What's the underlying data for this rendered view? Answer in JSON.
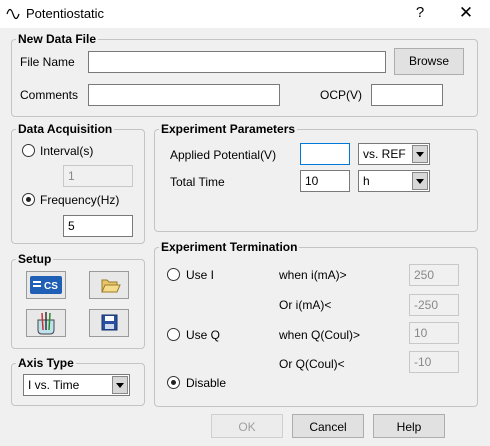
{
  "window": {
    "title": "Potentiostatic",
    "help_glyph": "?",
    "close_glyph": "✕"
  },
  "new_data_file": {
    "legend": "New Data File",
    "file_name_label": "File Name",
    "file_name_value": "",
    "browse_label": "Browse",
    "comments_label": "Comments",
    "comments_value": "",
    "ocp_label": "OCP(V)",
    "ocp_value": ""
  },
  "data_acquisition": {
    "legend": "Data Acquisition",
    "interval_label": "Interval(s)",
    "interval_value": "1",
    "frequency_label": "Frequency(Hz)",
    "frequency_value": "5",
    "selected": "frequency"
  },
  "experiment_parameters": {
    "legend": "Experiment Parameters",
    "applied_potential_label": "Applied Potential(V)",
    "applied_potential_value": "",
    "reference_selected": "vs. REF",
    "total_time_label": "Total Time",
    "total_time_value": "10",
    "time_unit_selected": "h"
  },
  "setup": {
    "legend": "Setup",
    "icons": [
      "cs-device-icon",
      "open-folder-icon",
      "cell-electrodes-icon",
      "save-disk-icon"
    ],
    "cs_text": "CS"
  },
  "experiment_termination": {
    "legend": "Experiment Termination",
    "use_i_label": "Use I",
    "when_i_label": "when i(mA)>",
    "when_i_value": "250",
    "or_i_label": "Or i(mA)<",
    "or_i_value": "-250",
    "use_q_label": "Use Q",
    "when_q_label": "when Q(Coul)>",
    "when_q_value": "10",
    "or_q_label": "Or Q(Coul)<",
    "or_q_value": "-10",
    "disable_label": "Disable",
    "selected": "disable"
  },
  "axis_type": {
    "legend": "Axis Type",
    "selected": "I vs. Time"
  },
  "footer": {
    "ok_label": "OK",
    "cancel_label": "Cancel",
    "help_label": "Help"
  },
  "colors": {
    "focus_border": "#0078d7",
    "cs_icon_blue": "#1f5fb5"
  }
}
